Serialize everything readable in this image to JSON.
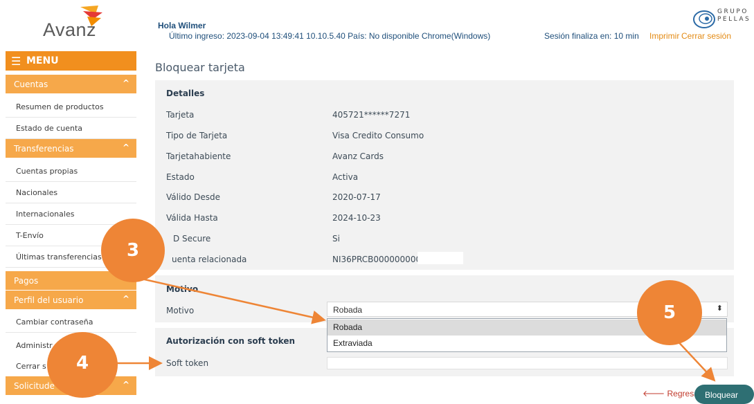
{
  "brand": {
    "logo_text": "Avanz",
    "partner_logo_line1": "GRUPO",
    "partner_logo_line2": "PELLAS"
  },
  "header": {
    "greeting": "Hola Wilmer",
    "last_login": "Último ingreso: 2023-09-04 13:49:41 10.10.5.40 País: No disponible Chrome(Windows)",
    "session": "Sesión finaliza en: 10 min",
    "print_link": "Imprimir",
    "logout_link": "Cerrar sesión"
  },
  "sidebar": {
    "menu_label": "MENU",
    "sections": [
      {
        "label": "Cuentas",
        "items": [
          "Resumen de productos",
          "Estado de cuenta"
        ]
      },
      {
        "label": "Transferencias",
        "items": [
          "Cuentas propias",
          "Nacionales",
          "Internacionales",
          "T-Envío",
          "Últimas transferencias"
        ]
      },
      {
        "label": "Pagos",
        "items": []
      },
      {
        "label": "Perfil del usuario",
        "items": [
          "Cambiar contraseña",
          "Administr",
          "Cerrar s"
        ]
      },
      {
        "label": "Solicitude",
        "items": []
      }
    ]
  },
  "page": {
    "title": "Bloquear tarjeta",
    "details_title": "Detalles",
    "details": [
      {
        "label": "Tarjeta",
        "value": "405721******7271"
      },
      {
        "label": "Tipo de Tarjeta",
        "value": "Visa Credito Consumo"
      },
      {
        "label": "Tarjetahabiente",
        "value": "Avanz Cards"
      },
      {
        "label": "Estado",
        "value": "Activa"
      },
      {
        "label": "Válido Desde",
        "value": "2020-07-17"
      },
      {
        "label": "Válida Hasta",
        "value": "2024-10-23"
      },
      {
        "label": "D Secure",
        "value": "Si"
      },
      {
        "label": "uenta relacionada",
        "value": "NI36PRCB0000000000"
      }
    ],
    "motivo_title": "Motivo",
    "motivo_label": "Motivo",
    "motivo_selected": "Robada",
    "motivo_options": [
      "Robada",
      "Extraviada"
    ],
    "token_title": "Autorización con soft token",
    "token_label": "Soft token",
    "back_button": "Regresar",
    "block_button": "Bloquear"
  },
  "callouts": [
    "3",
    "4",
    "5"
  ],
  "colors": {
    "brand_orange": "#f18f1e",
    "section_orange": "#f6a84a",
    "callout_orange": "#ee8536",
    "teal_button": "#2e6f73",
    "panel_gray": "#f2f2f2"
  }
}
